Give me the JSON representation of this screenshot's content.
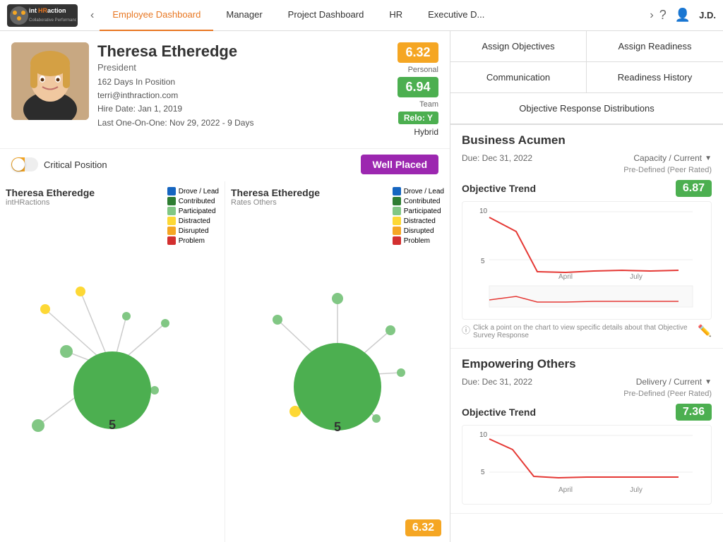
{
  "nav": {
    "tabs": [
      {
        "label": "Employee Dashboard",
        "active": true
      },
      {
        "label": "Manager",
        "active": false
      },
      {
        "label": "Project Dashboard",
        "active": false
      },
      {
        "label": "HR",
        "active": false
      },
      {
        "label": "Executive D...",
        "active": false
      }
    ],
    "user": "J.D.",
    "prev_arrow": "‹",
    "next_arrow": "›"
  },
  "profile": {
    "name": "Theresa Etheredge",
    "title": "President",
    "days_in_position": "162 Days In Position",
    "email": "terri@inthraction.com",
    "hire_date": "Hire Date: Jan 1, 2019",
    "last_one_on_one": "Last One-On-One: Nov 29, 2022 - 9 Days",
    "score_personal": "6.32",
    "score_personal_label": "Personal",
    "score_team": "6.94",
    "score_team_label": "Team",
    "relo_badge": "Relo: Y",
    "hybrid_badge": "Hybrid",
    "critical_position_label": "Critical Position",
    "well_placed_label": "Well Placed"
  },
  "charts": [
    {
      "title": "Theresa Etheredge",
      "subtitle": "intHRactions",
      "legend": [
        {
          "label": "Drove / Lead",
          "color": "#1565c0"
        },
        {
          "label": "Contributed",
          "color": "#2e7d32"
        },
        {
          "label": "Participated",
          "color": "#81c784"
        },
        {
          "label": "Distracted",
          "color": "#fdd835"
        },
        {
          "label": "Disrupted",
          "color": "#f5a623"
        },
        {
          "label": "Problem",
          "color": "#d32f2f"
        }
      ]
    },
    {
      "title": "Theresa Etheredge",
      "subtitle": "Rates Others",
      "legend": [
        {
          "label": "Drove / Lead",
          "color": "#1565c0"
        },
        {
          "label": "Contributed",
          "color": "#2e7d32"
        },
        {
          "label": "Participated",
          "color": "#81c784"
        },
        {
          "label": "Distracted",
          "color": "#fdd835"
        },
        {
          "label": "Disrupted",
          "color": "#f5a623"
        },
        {
          "label": "Problem",
          "color": "#d32f2f"
        }
      ]
    }
  ],
  "bottom_score": "6.32",
  "action_buttons": {
    "assign_objectives": "Assign Objectives",
    "assign_readiness": "Assign Readiness",
    "communication": "Communication",
    "readiness_history": "Readiness History",
    "objective_distributions": "Objective Response Distributions"
  },
  "objectives": [
    {
      "title": "Business Acumen",
      "due": "Due: Dec 31, 2022",
      "capacity_type": "Capacity / Current",
      "rating_type": "Pre-Defined (Peer Rated)",
      "trend_label": "Objective Trend",
      "trend_score": "6.87",
      "trend_score_color": "green",
      "x_labels": [
        "April",
        "July"
      ],
      "chart_note": "Click a point on the chart to view specific details about that Objective Survey Response"
    },
    {
      "title": "Empowering Others",
      "due": "Due: Dec 31, 2022",
      "capacity_type": "Delivery / Current",
      "rating_type": "Pre-Defined (Peer Rated)",
      "trend_label": "Objective Trend",
      "trend_score": "7.36",
      "trend_score_color": "green",
      "x_labels": [
        "April",
        "July"
      ],
      "chart_note": ""
    }
  ]
}
